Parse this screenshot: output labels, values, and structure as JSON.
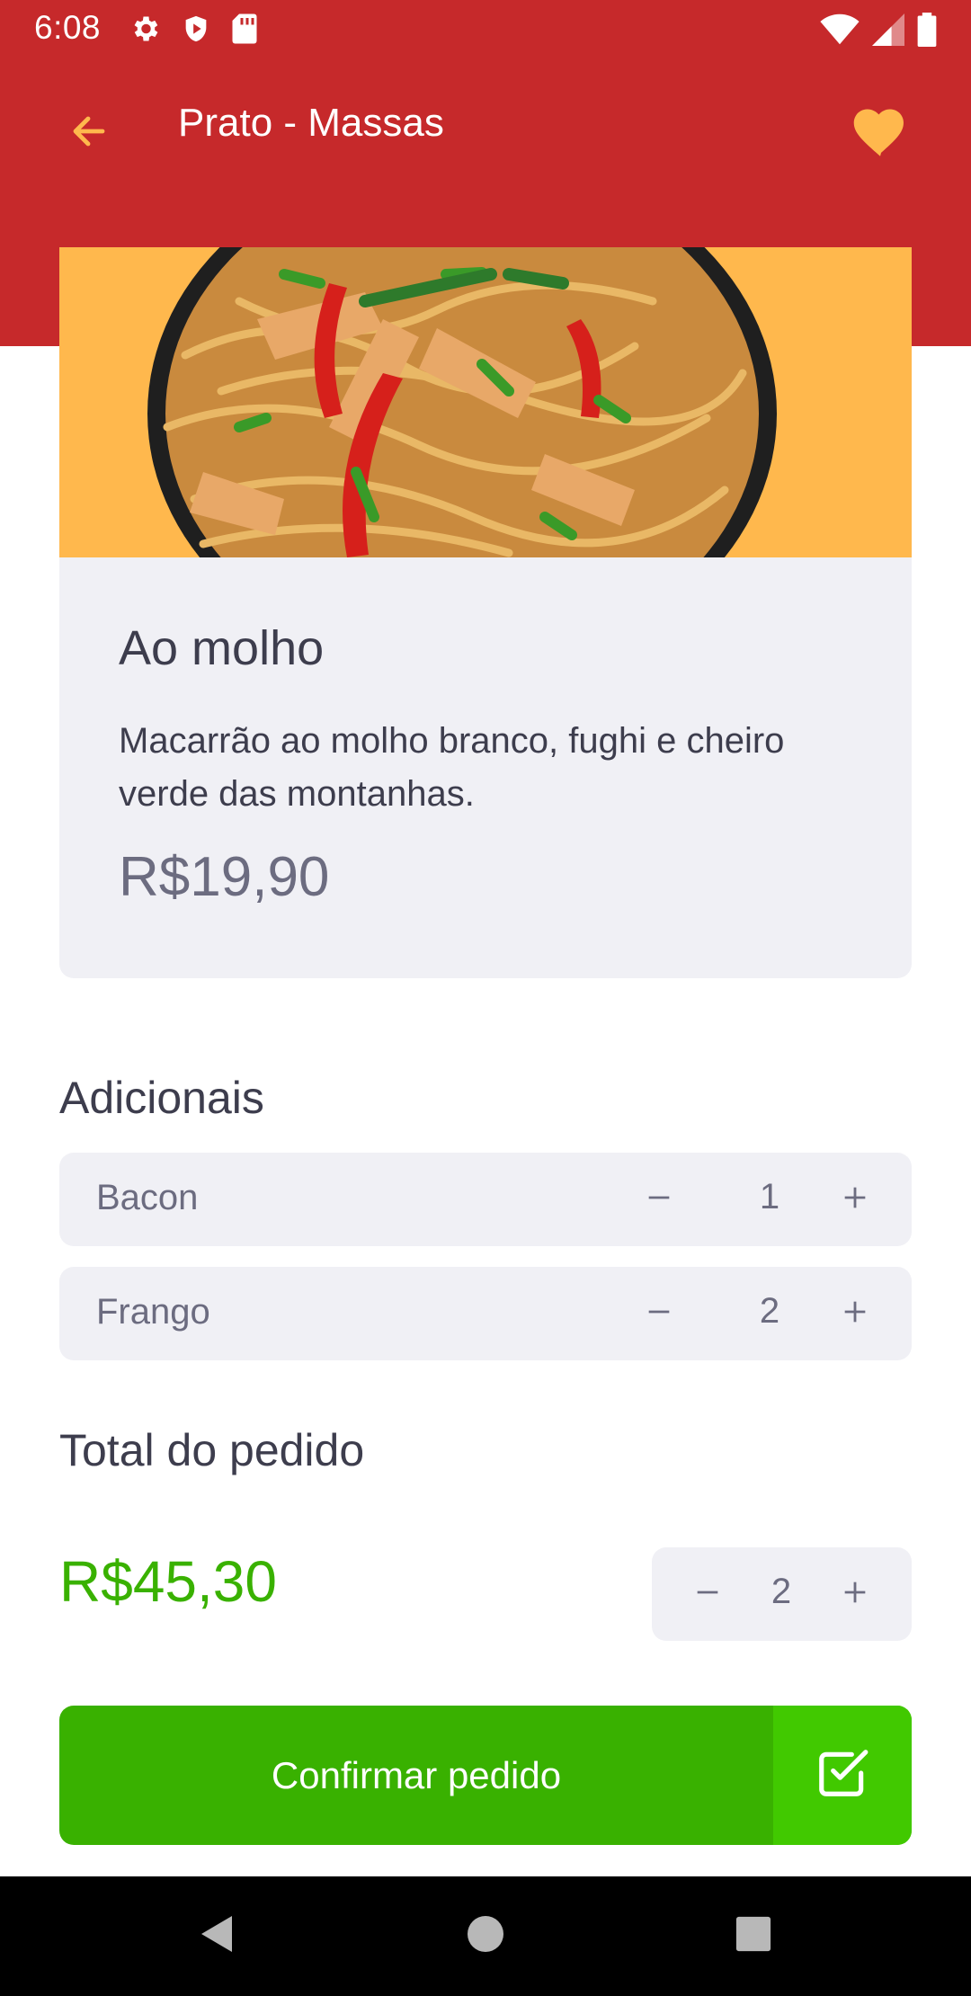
{
  "status_bar": {
    "time": "6:08",
    "left_icons": [
      "gear-icon",
      "shield-play-icon",
      "sd-card-icon"
    ],
    "right_icons": [
      "wifi-icon",
      "signal-icon",
      "battery-icon"
    ]
  },
  "app_bar": {
    "title": "Prato - Massas",
    "back_icon": "arrow-left-icon",
    "favorite_icon": "heart-icon",
    "accent_color": "#ffb84d",
    "background_color": "#c6292b"
  },
  "product": {
    "image": "pasta-dish-image",
    "name": "Ao molho",
    "description": "Macarrão ao molho branco, fughi e cheiro verde das montanhas.",
    "price": "R$19,90"
  },
  "extras": {
    "title": "Adicionais",
    "items": [
      {
        "name": "Bacon",
        "quantity": "1"
      },
      {
        "name": "Frango",
        "quantity": "2"
      }
    ]
  },
  "order": {
    "total_title": "Total do pedido",
    "total_value": "R$45,30",
    "quantity": "2",
    "total_color": "#39b100"
  },
  "confirm": {
    "label": "Confirmar pedido",
    "icon": "check-square-icon"
  },
  "nav_bar": {
    "icons": [
      "back-triangle-icon",
      "home-circle-icon",
      "recents-square-icon"
    ]
  }
}
